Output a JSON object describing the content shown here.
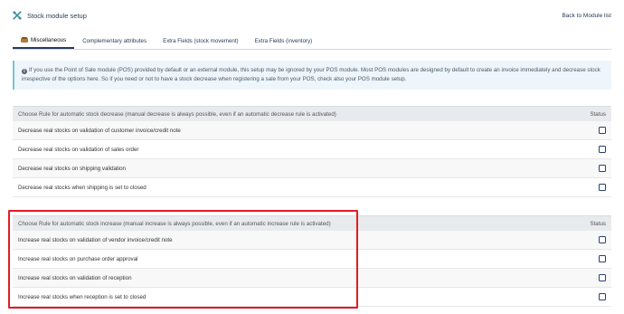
{
  "header": {
    "title": "Stock module setup",
    "back_link": "Back to Module list"
  },
  "tabs": [
    {
      "label": "Miscellaneous",
      "active": true
    },
    {
      "label": "Complementary attributes",
      "active": false
    },
    {
      "label": "Extra Fields (stock movement)",
      "active": false
    },
    {
      "label": "Extra Fields (inventory)",
      "active": false
    }
  ],
  "info": {
    "line1": "If you use the Point of Sale module (POS) provided by default or an external module, this setup may be ignored by your POS module. Most POS modules are designed by default to create an invoice immediately and decrease stock",
    "line2": "irrespective of the options here. So if you need or not to have a stock decrease when registering a sale from your POS, check also your POS module setup."
  },
  "decrease": {
    "heading": "Choose Rule for automatic stock decrease (manual decrease is always possible, even if an automatic decrease rule is activated)",
    "status_label": "Status",
    "rows": [
      {
        "label": "Decrease real stocks on validation of customer invoice/credit note",
        "checked": false
      },
      {
        "label": "Decrease real stocks on validation of sales order",
        "checked": false
      },
      {
        "label": "Decrease real stocks on shipping validation",
        "checked": false
      },
      {
        "label": "Decrease real stocks when shipping is set to closed",
        "checked": false
      }
    ]
  },
  "increase": {
    "heading": "Choose Rule for automatic stock increase (manual increase is always possible, even if an automatic increase rule is activated)",
    "status_label": "Status",
    "rows": [
      {
        "label": "Increase real stocks on validation of vendor invoice/credit note",
        "checked": false
      },
      {
        "label": "Increase real stocks on purchase order approval",
        "checked": false
      },
      {
        "label": "Increase real stocks on validation of reception",
        "checked": false
      },
      {
        "label": "Increase real stocks when reception is set to closed",
        "checked": false
      }
    ]
  },
  "colors": {
    "accent": "#263c5c",
    "highlight": "#e31b23",
    "info_bg": "#eef6fb"
  }
}
